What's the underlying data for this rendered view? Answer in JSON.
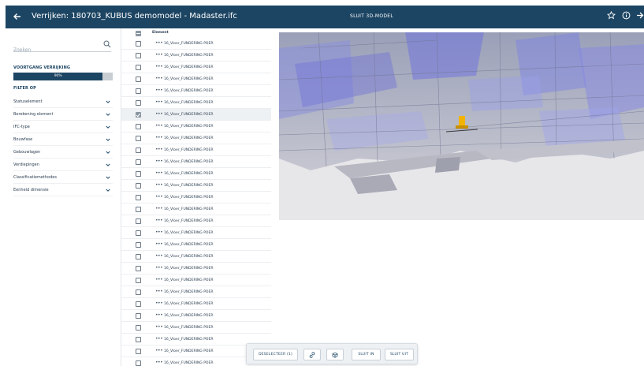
{
  "header": {
    "title": "Verrijken: 180703_KUBUS demomodel - Madaster.ifc",
    "close_model_label": "SLUIT 3D-MODEL",
    "icons": [
      "arrow-left-icon",
      "star-icon",
      "info-icon",
      "arrow-right-icon"
    ]
  },
  "sidebar": {
    "search_placeholder": "Zoeken",
    "progress_title": "VOORTGANG VERRIJKING",
    "progress_label": "90%",
    "progress_value": 90,
    "filter_title": "FILTER OP",
    "filters": [
      "Statuselement",
      "Berekening element",
      "IFC-type",
      "Bouwfase",
      "Gebouwlagen",
      "Verdiepingen",
      "Classificatiemethodes",
      "Eenheid dimensie"
    ]
  },
  "list": {
    "header_label": "Element",
    "rows": [
      {
        "label": "16_Vloer_FUNDERING POER",
        "checked": false
      },
      {
        "label": "16_Vloer_FUNDERING POER",
        "checked": false
      },
      {
        "label": "16_Vloer_FUNDERING POER",
        "checked": false
      },
      {
        "label": "16_Vloer_FUNDERING POER",
        "checked": false
      },
      {
        "label": "16_Vloer_FUNDERING POER",
        "checked": false
      },
      {
        "label": "16_Vloer_FUNDERING POER",
        "checked": false
      },
      {
        "label": "16_Vloer_FUNDERING POER",
        "checked": true
      },
      {
        "label": "16_Vloer_FUNDERING POER",
        "checked": false
      },
      {
        "label": "16_Vloer_FUNDERING POER",
        "checked": false
      },
      {
        "label": "16_Vloer_FUNDERING POER",
        "checked": false
      },
      {
        "label": "16_Vloer_FUNDERING POER",
        "checked": false
      },
      {
        "label": "16_Vloer_FUNDERING POER",
        "checked": false
      },
      {
        "label": "16_Vloer_FUNDERING POER",
        "checked": false
      },
      {
        "label": "16_Vloer_FUNDERING POER",
        "checked": false
      },
      {
        "label": "16_Vloer_FUNDERING POER",
        "checked": false
      },
      {
        "label": "16_Vloer_FUNDERING POER",
        "checked": false
      },
      {
        "label": "16_Vloer_FUNDERING POER",
        "checked": false
      },
      {
        "label": "16_Vloer_FUNDERING POER",
        "checked": false
      },
      {
        "label": "16_Vloer_FUNDERING POER",
        "checked": false
      },
      {
        "label": "16_Vloer_FUNDERING POER",
        "checked": false
      },
      {
        "label": "16_Vloer_FUNDERING POER",
        "checked": false
      },
      {
        "label": "16_Vloer_FUNDERING POER",
        "checked": false
      },
      {
        "label": "16_Vloer_FUNDERING POER",
        "checked": false
      },
      {
        "label": "16_Vloer_FUNDERING POER",
        "checked": false
      },
      {
        "label": "16_Vloer_FUNDERING POER",
        "checked": false
      },
      {
        "label": "16_Vloer_FUNDERING POER",
        "checked": false
      },
      {
        "label": "16_Vloer_FUNDERING POER",
        "checked": false
      },
      {
        "label": "16_Vloer_FUNDERING POER",
        "checked": false
      }
    ]
  },
  "toolbar": {
    "deselect_label": "DESELECTEER (1)",
    "hide_label": "SLUIT IN",
    "show_label": "SLUIT UIT",
    "icons": [
      "link-icon",
      "cube-icon"
    ]
  },
  "colors": {
    "header_bg": "#1c4563",
    "accent": "#1c4563",
    "model_highlight": "#f2b400"
  }
}
